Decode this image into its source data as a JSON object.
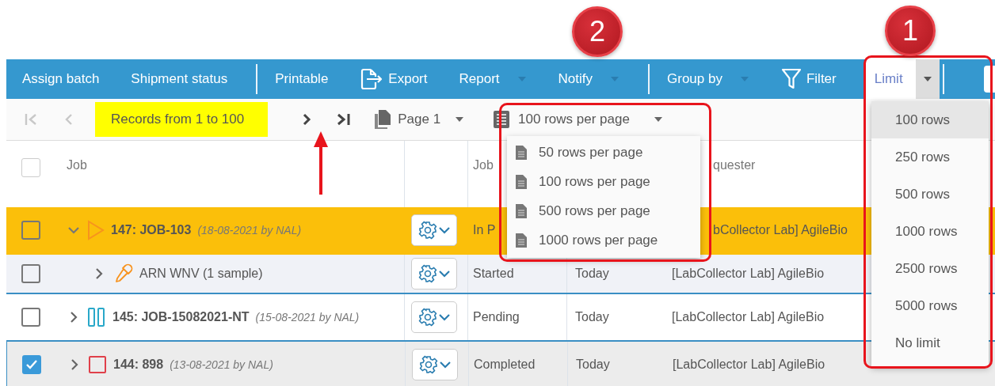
{
  "annotations": [
    {
      "kind": "badge",
      "label": "2"
    },
    {
      "kind": "badge",
      "label": "1"
    }
  ],
  "toolbar": {
    "items": [
      {
        "kind": "button",
        "label": "Assign batch"
      },
      {
        "kind": "button",
        "label": "Shipment status"
      },
      {
        "kind": "separator"
      },
      {
        "kind": "button",
        "label": "Printable"
      },
      {
        "kind": "export",
        "label": "Export"
      },
      {
        "kind": "menu",
        "label": "Report"
      },
      {
        "kind": "menu",
        "label": "Notify"
      },
      {
        "kind": "separator"
      },
      {
        "kind": "menu",
        "label": "Group by"
      },
      {
        "kind": "filter",
        "label": "Filter"
      },
      {
        "kind": "select",
        "label": "Limit",
        "expanded": true,
        "options": [
          {
            "label": "100 rows",
            "selected": true
          },
          {
            "label": "250 rows",
            "selected": false
          },
          {
            "label": "500 rows",
            "selected": false
          },
          {
            "label": "1000 rows",
            "selected": false
          },
          {
            "label": "2500 rows",
            "selected": false
          },
          {
            "label": "5000 rows",
            "selected": false
          },
          {
            "label": "No limit",
            "selected": false
          }
        ]
      },
      {
        "kind": "separator"
      },
      {
        "kind": "stub"
      }
    ]
  },
  "pager": {
    "first": {
      "disabled": true
    },
    "previous": {
      "disabled": true
    },
    "records": "Records from 1 to 100",
    "next": {
      "disabled": false
    },
    "last": {
      "disabled": false
    },
    "page": "Page 1",
    "rows_per_page": {
      "label": "100 rows per page",
      "expanded": true,
      "options": [
        {
          "label": "50 rows per page",
          "selected": false
        },
        {
          "label": "100 rows per page",
          "selected": false
        },
        {
          "label": "500 rows per page",
          "selected": false
        },
        {
          "label": "1000 rows per page",
          "selected": false
        }
      ]
    }
  },
  "table": {
    "header": {
      "checked": false,
      "column_1": "Job",
      "column_3": "Job",
      "column_5": "quester"
    },
    "rows": [
      {
        "kind": "running",
        "color": "#f7931e",
        "checked": false,
        "selected": true,
        "expanded": true,
        "title": "147: JOB-103",
        "meta": "(18-08-2021 by NAL)",
        "status": "In P",
        "requester": "bCollector Lab] AgileBio",
        "children": [
          {
            "kind": "sample",
            "color": "#f7931e",
            "checked": false,
            "selected": false,
            "expanded": false,
            "title": "ARN WNV (1 sample)",
            "status": "Started",
            "date": "Today",
            "requester": "[LabCollector Lab] AgileBio"
          }
        ]
      },
      {
        "kind": "paused",
        "color": "#29a8c9",
        "checked": false,
        "selected": false,
        "expanded": false,
        "title": "145: JOB-15082021-NT",
        "meta": "(15-08-2021 by NAL)",
        "status": "Pending",
        "date": "Today",
        "requester": "[LabCollector Lab] AgileBio"
      },
      {
        "kind": "stopped",
        "color": "#e0404a",
        "checked": true,
        "selected": false,
        "expanded": false,
        "title": "144: 898",
        "meta": "(13-08-2021 by NAL)",
        "status": "Completed",
        "date": "Today",
        "requester": "[LabCollector Lab] AgileBio"
      }
    ]
  }
}
